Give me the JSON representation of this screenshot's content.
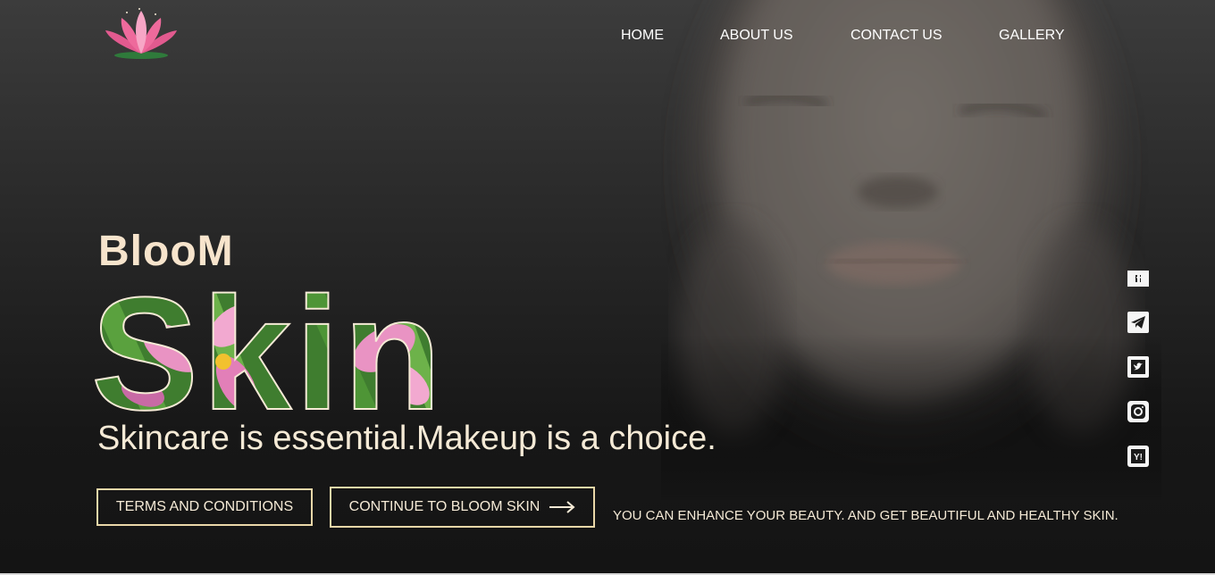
{
  "logo": {
    "icon": "lotus-icon",
    "colors": {
      "petal": "#ee6a9c",
      "petal_light": "#f7a6c6",
      "leaf": "#2f7a3b"
    }
  },
  "nav": {
    "items": [
      {
        "label": "HOME"
      },
      {
        "label": "ABOUT US"
      },
      {
        "label": "CONTACT US"
      },
      {
        "label": "GALLERY"
      }
    ]
  },
  "hero": {
    "brand": "BlooM",
    "title": "Skin",
    "tagline": "Skincare is essential.Makeup is a choice.",
    "terms_button": "TERMS AND CONDITIONS",
    "continue_button": "CONTINUE TO BLOOM SKIN",
    "promo": "YOU CAN ENHANCE YOUR BEAUTY. AND GET BEAUTIFUL AND HEALTHY SKIN."
  },
  "social": {
    "icons": [
      "facebook-icon",
      "telegram-icon",
      "twitter-icon",
      "instagram-icon",
      "yahoo-icon"
    ]
  },
  "colors": {
    "accent": "#e9d7a8",
    "text": "#f5ead6",
    "background": "#1b1b1b"
  }
}
